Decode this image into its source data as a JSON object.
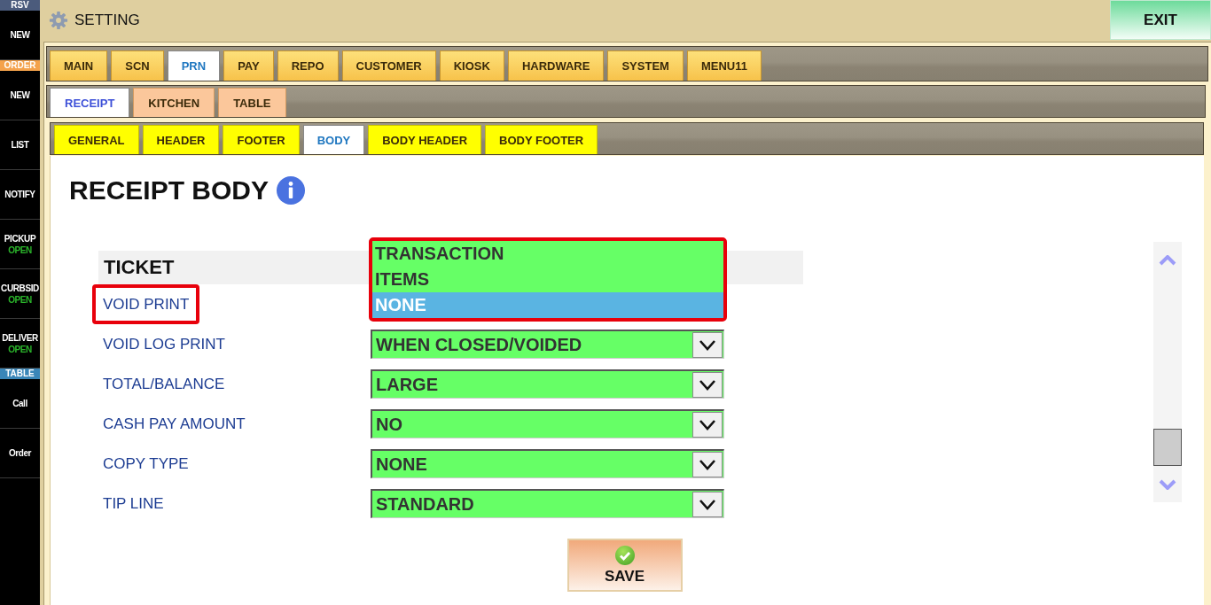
{
  "sidebar": {
    "groups": [
      {
        "title": "RSV",
        "color": "#4b5b7c",
        "items": [
          {
            "label": "NEW"
          }
        ]
      },
      {
        "title": "ORDER",
        "color": "#f4a24c",
        "items": [
          {
            "label": "NEW"
          },
          {
            "label": "LIST"
          },
          {
            "label": "NOTIFY"
          },
          {
            "label": "PICKUP",
            "status": "OPEN"
          },
          {
            "label": "CURBSID",
            "status": "OPEN"
          },
          {
            "label": "DELIVER",
            "status": "OPEN"
          }
        ]
      },
      {
        "title": "TABLE",
        "color": "#3a86b8",
        "items": [
          {
            "label": "Call"
          },
          {
            "label": "Order"
          }
        ]
      }
    ]
  },
  "header": {
    "title": "SETTING",
    "exit_button": "EXIT"
  },
  "main_tabs": [
    {
      "label": "MAIN",
      "selected": false
    },
    {
      "label": "SCN",
      "selected": false
    },
    {
      "label": "PRN",
      "selected": true
    },
    {
      "label": "PAY",
      "selected": false
    },
    {
      "label": "REPO",
      "selected": false
    },
    {
      "label": "CUSTOMER",
      "selected": false
    },
    {
      "label": "KIOSK",
      "selected": false
    },
    {
      "label": "HARDWARE",
      "selected": false
    },
    {
      "label": "SYSTEM",
      "selected": false
    },
    {
      "label": "MENU11",
      "selected": false
    }
  ],
  "sub_tabs": [
    {
      "label": "RECEIPT",
      "selected": true
    },
    {
      "label": "KITCHEN",
      "selected": false
    },
    {
      "label": "TABLE",
      "selected": false
    }
  ],
  "section_tabs": [
    {
      "label": "GENERAL",
      "selected": false
    },
    {
      "label": "HEADER",
      "selected": false
    },
    {
      "label": "FOOTER",
      "selected": false
    },
    {
      "label": "BODY",
      "selected": true
    },
    {
      "label": "BODY HEADER",
      "selected": false
    },
    {
      "label": "BODY FOOTER",
      "selected": false
    }
  ],
  "page": {
    "title": "RECEIPT BODY",
    "section": "TICKET",
    "rows": [
      {
        "label": "VOID PRINT",
        "highlighted": true,
        "open": true,
        "options": [
          {
            "label": "TRANSACTION",
            "selected": false
          },
          {
            "label": "ITEMS",
            "selected": false
          },
          {
            "label": "NONE",
            "selected": true
          }
        ]
      },
      {
        "label": "VOID LOG PRINT",
        "highlighted": false,
        "open": false,
        "value": "WHEN CLOSED/VOIDED"
      },
      {
        "label": "TOTAL/BALANCE",
        "highlighted": false,
        "open": false,
        "value": "LARGE"
      },
      {
        "label": "CASH PAY AMOUNT",
        "highlighted": false,
        "open": false,
        "value": "NO"
      },
      {
        "label": "COPY TYPE",
        "highlighted": false,
        "open": false,
        "value": "NONE"
      },
      {
        "label": "TIP LINE",
        "highlighted": false,
        "open": false,
        "value": "STANDARD"
      }
    ],
    "save_button": "SAVE"
  }
}
